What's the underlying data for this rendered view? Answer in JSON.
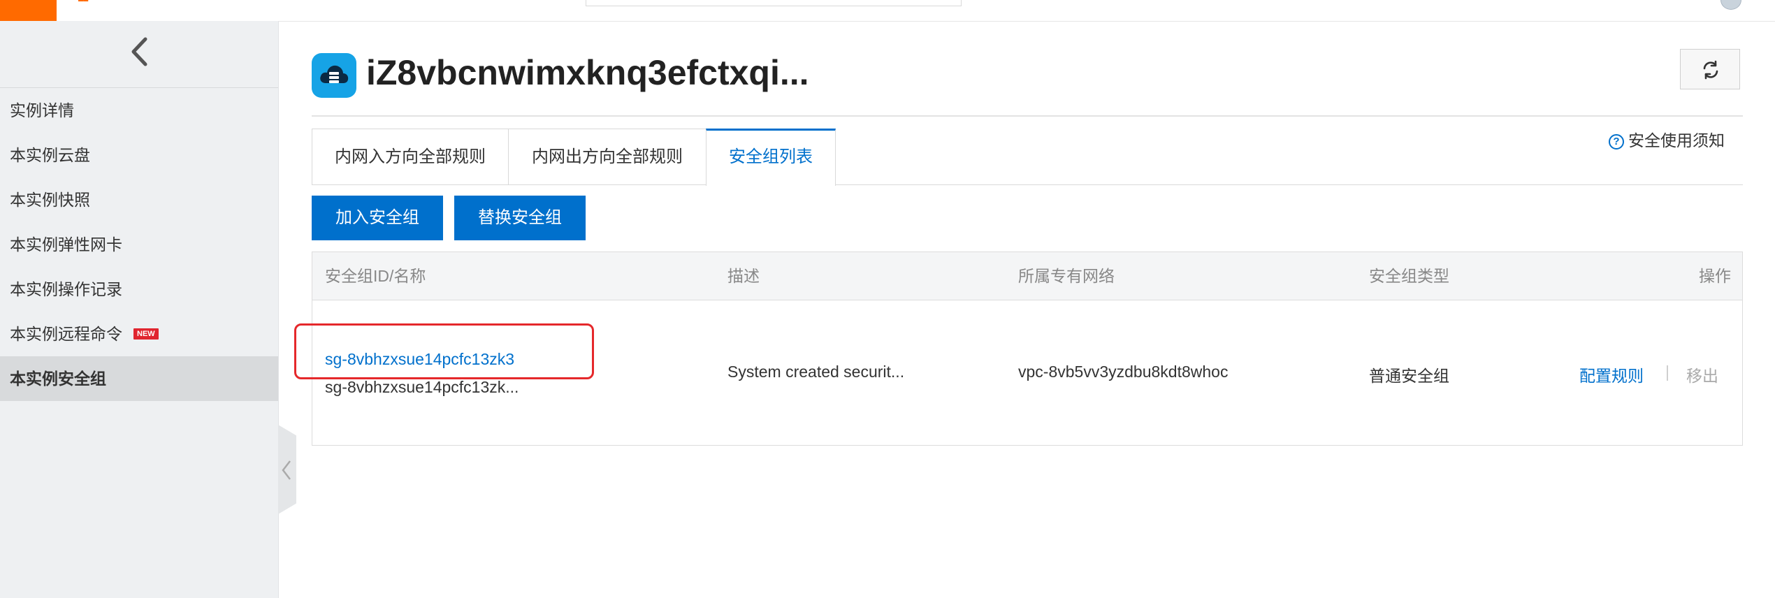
{
  "header": {
    "instance_title": "iZ8vbcnwimxknq3efctxqi...",
    "notice_icon": "?",
    "notice_label": "安全使用须知"
  },
  "sidebar": {
    "items": [
      {
        "label": "实例详情"
      },
      {
        "label": "本实例云盘"
      },
      {
        "label": "本实例快照"
      },
      {
        "label": "本实例弹性网卡"
      },
      {
        "label": "本实例操作记录"
      },
      {
        "label": "本实例远程命令",
        "badge": "NEW"
      },
      {
        "label": "本实例安全组"
      }
    ],
    "active_item": "本实例安全组"
  },
  "tabs": [
    {
      "label": "内网入方向全部规则"
    },
    {
      "label": "内网出方向全部规则"
    },
    {
      "label": "安全组列表"
    }
  ],
  "active_tab": "安全组列表",
  "toolbar": {
    "join_label": "加入安全组",
    "replace_label": "替换安全组"
  },
  "table": {
    "columns": [
      "安全组ID/名称",
      "描述",
      "所属专有网络",
      "安全组类型",
      "操作"
    ],
    "rows": [
      {
        "id": "sg-8vbhzxsue14pcfc13zk3",
        "name": "sg-8vbhzxsue14pcfc13zk...",
        "description": "System created securit...",
        "vpc": "vpc-8vb5vv3yzdbu8kdt8whoc",
        "type": "普通安全组",
        "action_config": "配置规则",
        "action_separator": "|",
        "action_remove": "移出"
      }
    ]
  },
  "colors": {
    "brand_orange": "#ff6a00",
    "primary_blue": "#0070cc",
    "highlight_red": "#e5282b",
    "badge_red": "#e0252f"
  },
  "icons": {
    "collapse": "chevron-left-icon",
    "instance": "cloud-server-icon",
    "refresh": "refresh-icon",
    "notice": "help-circle-icon"
  }
}
